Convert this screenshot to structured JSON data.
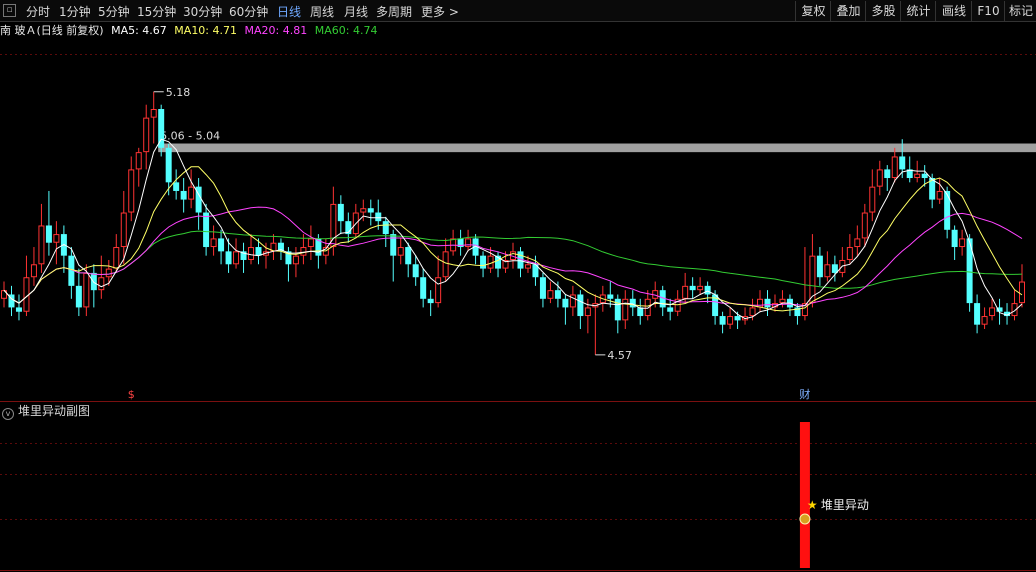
{
  "toolbar": {
    "settings_icon": "small-square-icon",
    "periods": [
      {
        "label": "分时",
        "active": false
      },
      {
        "label": "1分钟",
        "active": false
      },
      {
        "label": "5分钟",
        "active": false
      },
      {
        "label": "15分钟",
        "active": false
      },
      {
        "label": "30分钟",
        "active": false
      },
      {
        "label": "60分钟",
        "active": false
      },
      {
        "label": "日线",
        "active": true
      },
      {
        "label": "周线",
        "active": false
      },
      {
        "label": "月线",
        "active": false
      },
      {
        "label": "多周期",
        "active": false
      },
      {
        "label": "更多 >",
        "active": false
      }
    ],
    "right_buttons": [
      "复权",
      "叠加",
      "多股",
      "统计",
      "画线",
      "F10",
      "标记"
    ]
  },
  "legend": {
    "title": "南 玻Ａ(日线 前复权)",
    "ma": [
      {
        "label": "MA5: 4.67",
        "color": "#ffffff"
      },
      {
        "label": "MA10: 4.71",
        "color": "#ffff66"
      },
      {
        "label": "MA20: 4.81",
        "color": "#ff44ff"
      },
      {
        "label": "MA60: 4.74",
        "color": "#33cc33"
      }
    ]
  },
  "sub_panel": {
    "title": "堆里异动副图",
    "signal_label": "堆里异动"
  },
  "chart_data": {
    "type": "candlestick",
    "ylim": [
      4.47,
      5.3
    ],
    "colors": {
      "up": "#ff3333",
      "down": "#54ffff",
      "ma5": "#ffffff",
      "ma10": "#ffff66",
      "ma20": "#ff44ff",
      "ma60": "#33cc33",
      "band": "#a0a0a0",
      "signal": "#ff1010"
    },
    "annotations": {
      "high": {
        "label": "5.18",
        "value": 5.18,
        "index": 20
      },
      "low": {
        "label": "4.57",
        "value": 4.57,
        "index": 79
      },
      "band": {
        "label": "5.06 - 5.04",
        "from": 5.06,
        "to": 5.04,
        "start_index": 21
      },
      "markers": [
        {
          "label": "$",
          "index": 17,
          "color": "#ff4444",
          "icon": "dollar-icon"
        },
        {
          "label": "财",
          "index": 107,
          "color": "#7fb0ff",
          "icon": "finance-icon"
        }
      ],
      "signal_index": 107
    },
    "candles": [
      [
        4.7,
        4.72,
        4.74,
        4.68
      ],
      [
        4.71,
        4.68,
        4.73,
        4.66
      ],
      [
        4.68,
        4.67,
        4.71,
        4.65
      ],
      [
        4.67,
        4.75,
        4.8,
        4.66
      ],
      [
        4.75,
        4.78,
        4.82,
        4.73
      ],
      [
        4.78,
        4.87,
        4.92,
        4.76
      ],
      [
        4.87,
        4.83,
        4.95,
        4.8
      ],
      [
        4.83,
        4.85,
        4.88,
        4.78
      ],
      [
        4.85,
        4.8,
        4.87,
        4.76
      ],
      [
        4.8,
        4.73,
        4.82,
        4.7
      ],
      [
        4.73,
        4.68,
        4.77,
        4.66
      ],
      [
        4.68,
        4.76,
        4.78,
        4.66
      ],
      [
        4.76,
        4.72,
        4.78,
        4.68
      ],
      [
        4.72,
        4.75,
        4.8,
        4.7
      ],
      [
        4.75,
        4.77,
        4.79,
        4.73
      ],
      [
        4.77,
        4.82,
        4.85,
        4.76
      ],
      [
        4.82,
        4.9,
        4.95,
        4.78
      ],
      [
        4.9,
        5.0,
        5.03,
        4.88
      ],
      [
        5.0,
        5.04,
        5.05,
        4.96
      ],
      [
        5.04,
        5.12,
        5.15,
        5.0
      ],
      [
        5.12,
        5.14,
        5.18,
        5.06
      ],
      [
        5.14,
        5.05,
        5.15,
        5.03
      ],
      [
        5.05,
        4.97,
        5.06,
        4.94
      ],
      [
        4.97,
        4.95,
        5.0,
        4.93
      ],
      [
        4.95,
        4.93,
        4.98,
        4.9
      ],
      [
        4.93,
        4.96,
        5.0,
        4.91
      ],
      [
        4.96,
        4.9,
        4.98,
        4.86
      ],
      [
        4.9,
        4.82,
        4.92,
        4.8
      ],
      [
        4.82,
        4.84,
        4.87,
        4.8
      ],
      [
        4.84,
        4.81,
        4.86,
        4.78
      ],
      [
        4.81,
        4.78,
        4.84,
        4.76
      ],
      [
        4.78,
        4.81,
        4.84,
        4.77
      ],
      [
        4.81,
        4.79,
        4.83,
        4.76
      ],
      [
        4.79,
        4.82,
        4.85,
        4.78
      ],
      [
        4.82,
        4.8,
        4.84,
        4.78
      ],
      [
        4.8,
        4.81,
        4.83,
        4.77
      ],
      [
        4.81,
        4.83,
        4.85,
        4.79
      ],
      [
        4.83,
        4.81,
        4.84,
        4.79
      ],
      [
        4.81,
        4.78,
        4.82,
        4.74
      ],
      [
        4.78,
        4.8,
        4.82,
        4.75
      ],
      [
        4.8,
        4.82,
        4.85,
        4.78
      ],
      [
        4.82,
        4.84,
        4.87,
        4.79
      ],
      [
        4.84,
        4.8,
        4.85,
        4.77
      ],
      [
        4.8,
        4.82,
        4.84,
        4.78
      ],
      [
        4.82,
        4.92,
        4.96,
        4.8
      ],
      [
        4.92,
        4.88,
        4.94,
        4.85
      ],
      [
        4.88,
        4.85,
        4.9,
        4.83
      ],
      [
        4.85,
        4.9,
        4.92,
        4.84
      ],
      [
        4.9,
        4.91,
        4.93,
        4.88
      ],
      [
        4.91,
        4.9,
        4.93,
        4.87
      ],
      [
        4.9,
        4.88,
        4.93,
        4.86
      ],
      [
        4.88,
        4.85,
        4.89,
        4.82
      ],
      [
        4.85,
        4.8,
        4.86,
        4.74
      ],
      [
        4.8,
        4.82,
        4.84,
        4.78
      ],
      [
        4.82,
        4.78,
        4.83,
        4.75
      ],
      [
        4.78,
        4.75,
        4.8,
        4.73
      ],
      [
        4.75,
        4.7,
        4.77,
        4.68
      ],
      [
        4.7,
        4.69,
        4.72,
        4.66
      ],
      [
        4.69,
        4.75,
        4.8,
        4.68
      ],
      [
        4.75,
        4.81,
        4.84,
        4.74
      ],
      [
        4.81,
        4.84,
        4.86,
        4.8
      ],
      [
        4.84,
        4.82,
        4.86,
        4.8
      ],
      [
        4.82,
        4.84,
        4.86,
        4.81
      ],
      [
        4.84,
        4.8,
        4.85,
        4.78
      ],
      [
        4.8,
        4.77,
        4.81,
        4.75
      ],
      [
        4.77,
        4.8,
        4.82,
        4.76
      ],
      [
        4.8,
        4.77,
        4.81,
        4.75
      ],
      [
        4.77,
        4.79,
        4.81,
        4.76
      ],
      [
        4.79,
        4.81,
        4.83,
        4.77
      ],
      [
        4.81,
        4.77,
        4.82,
        4.75
      ],
      [
        4.77,
        4.78,
        4.8,
        4.76
      ],
      [
        4.78,
        4.75,
        4.8,
        4.73
      ],
      [
        4.75,
        4.7,
        4.76,
        4.68
      ],
      [
        4.7,
        4.72,
        4.74,
        4.69
      ],
      [
        4.72,
        4.7,
        4.74,
        4.68
      ],
      [
        4.7,
        4.68,
        4.71,
        4.64
      ],
      [
        4.68,
        4.71,
        4.73,
        4.66
      ],
      [
        4.71,
        4.66,
        4.72,
        4.63
      ],
      [
        4.66,
        4.68,
        4.7,
        4.62
      ],
      [
        4.68,
        4.69,
        4.71,
        4.57
      ],
      [
        4.69,
        4.71,
        4.73,
        4.67
      ],
      [
        4.71,
        4.7,
        4.74,
        4.68
      ],
      [
        4.7,
        4.65,
        4.71,
        4.62
      ],
      [
        4.65,
        4.7,
        4.72,
        4.63
      ],
      [
        4.7,
        4.68,
        4.72,
        4.66
      ],
      [
        4.68,
        4.66,
        4.7,
        4.64
      ],
      [
        4.66,
        4.7,
        4.72,
        4.65
      ],
      [
        4.7,
        4.72,
        4.74,
        4.68
      ],
      [
        4.72,
        4.68,
        4.73,
        4.66
      ],
      [
        4.68,
        4.67,
        4.7,
        4.65
      ],
      [
        4.67,
        4.7,
        4.72,
        4.66
      ],
      [
        4.7,
        4.73,
        4.76,
        4.69
      ],
      [
        4.73,
        4.72,
        4.75,
        4.7
      ],
      [
        4.72,
        4.73,
        4.75,
        4.71
      ],
      [
        4.73,
        4.71,
        4.74,
        4.69
      ],
      [
        4.71,
        4.66,
        4.72,
        4.64
      ],
      [
        4.66,
        4.64,
        4.67,
        4.62
      ],
      [
        4.64,
        4.66,
        4.68,
        4.63
      ],
      [
        4.66,
        4.65,
        4.67,
        4.63
      ],
      [
        4.65,
        4.66,
        4.68,
        4.64
      ],
      [
        4.66,
        4.68,
        4.7,
        4.65
      ],
      [
        4.68,
        4.7,
        4.72,
        4.67
      ],
      [
        4.7,
        4.68,
        4.72,
        4.66
      ],
      [
        4.68,
        4.69,
        4.71,
        4.67
      ],
      [
        4.69,
        4.7,
        4.72,
        4.68
      ],
      [
        4.7,
        4.68,
        4.71,
        4.66
      ],
      [
        4.68,
        4.66,
        4.69,
        4.64
      ],
      [
        4.66,
        4.69,
        4.82,
        4.65
      ],
      [
        4.69,
        4.8,
        4.85,
        4.68
      ],
      [
        4.8,
        4.75,
        4.82,
        4.73
      ],
      [
        4.75,
        4.78,
        4.81,
        4.74
      ],
      [
        4.78,
        4.76,
        4.8,
        4.74
      ],
      [
        4.76,
        4.79,
        4.82,
        4.75
      ],
      [
        4.79,
        4.82,
        4.85,
        4.78
      ],
      [
        4.82,
        4.84,
        4.87,
        4.8
      ],
      [
        4.84,
        4.9,
        4.92,
        4.82
      ],
      [
        4.9,
        4.96,
        5.0,
        4.88
      ],
      [
        4.96,
        5.0,
        5.02,
        4.94
      ],
      [
        5.0,
        4.98,
        5.01,
        4.95
      ],
      [
        4.98,
        5.03,
        5.05,
        4.97
      ],
      [
        5.03,
        5.0,
        5.07,
        4.98
      ],
      [
        5.0,
        4.98,
        5.03,
        4.97
      ],
      [
        4.98,
        4.99,
        5.02,
        4.97
      ],
      [
        4.99,
        4.98,
        5.01,
        4.96
      ],
      [
        4.98,
        4.93,
        4.99,
        4.91
      ],
      [
        4.93,
        4.95,
        4.98,
        4.92
      ],
      [
        4.95,
        4.86,
        4.96,
        4.84
      ],
      [
        4.86,
        4.82,
        4.87,
        4.79
      ],
      [
        4.82,
        4.84,
        4.86,
        4.8
      ],
      [
        4.84,
        4.69,
        4.85,
        4.67
      ],
      [
        4.69,
        4.64,
        4.71,
        4.62
      ],
      [
        4.64,
        4.66,
        4.68,
        4.63
      ],
      [
        4.66,
        4.68,
        4.7,
        4.65
      ],
      [
        4.68,
        4.67,
        4.7,
        4.64
      ],
      [
        4.67,
        4.66,
        4.69,
        4.64
      ],
      [
        4.66,
        4.69,
        4.72,
        4.65
      ],
      [
        4.69,
        4.74,
        4.78,
        4.68
      ]
    ]
  }
}
